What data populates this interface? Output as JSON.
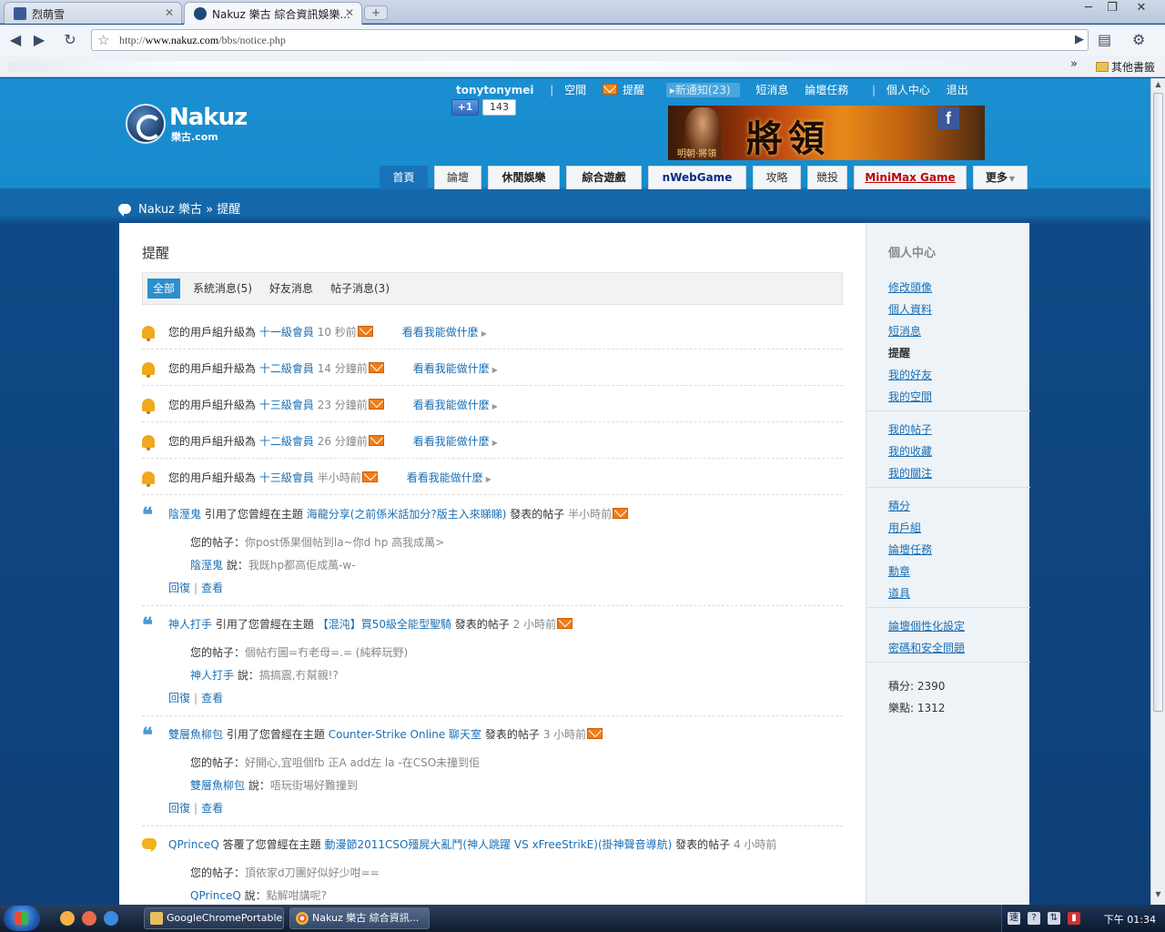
{
  "browser": {
    "tabs": [
      {
        "title": "烈萌雪",
        "active": false
      },
      {
        "title": "Nakuz 樂古 綜合資訊娛樂...",
        "active": true
      }
    ],
    "url_prefix": "http://",
    "url_host": "www.nakuz.com",
    "url_path": "/bbs/notice.php",
    "bookmarks_other": "其他書籤",
    "window_controls": [
      "─",
      "❐",
      "✕"
    ]
  },
  "header": {
    "logo_word": "Nakuz",
    "logo_sub": "樂古.com",
    "username": "tonytonymei",
    "usernav": {
      "space": "空間",
      "remind": "提醒",
      "new_notice": "新通知(23)",
      "pm": "短消息",
      "tasks": "論壇任務",
      "center": "個人中心",
      "logout": "退出"
    },
    "plusone_label": "+1",
    "plusone_count": "143",
    "banner_title": "將領",
    "banner_sub": "明朝·將領",
    "banner_fb": "f"
  },
  "mainnav": [
    {
      "label": "首頁",
      "style": "current"
    },
    {
      "label": "論壇",
      "style": ""
    },
    {
      "label": "休閒娛樂",
      "style": "bold"
    },
    {
      "label": "綜合遊戲",
      "style": "bold"
    },
    {
      "label": "nWebGame",
      "style": "navy"
    },
    {
      "label": "攻略",
      "style": ""
    },
    {
      "label": "競投",
      "style": ""
    },
    {
      "label": "MiniMax Game",
      "style": "red"
    },
    {
      "label": "更多",
      "style": "bold"
    }
  ],
  "breadcrumb": {
    "home": "Nakuz 樂古",
    "sep": "»",
    "current": "提醒"
  },
  "page_title": "提醒",
  "filters": [
    {
      "label": "全部",
      "active": true
    },
    {
      "label": "系統消息(5)",
      "active": false
    },
    {
      "label": "好友消息",
      "active": false
    },
    {
      "label": "帖子消息(3)",
      "active": false
    }
  ],
  "system_notices": [
    {
      "prefix": "您的用戶組升級為",
      "group": "十一級會員",
      "time": "10 秒前",
      "action": "看看我能做什麼"
    },
    {
      "prefix": "您的用戶組升級為",
      "group": "十二級會員",
      "time": "14 分鐘前",
      "action": "看看我能做什麼"
    },
    {
      "prefix": "您的用戶組升級為",
      "group": "十三級會員",
      "time": "23 分鐘前",
      "action": "看看我能做什麼"
    },
    {
      "prefix": "您的用戶組升級為",
      "group": "十二級會員",
      "time": "26 分鐘前",
      "action": "看看我能做什麼"
    },
    {
      "prefix": "您的用戶組升級為",
      "group": "十三級會員",
      "time": "半小時前",
      "action": "看看我能做什麼"
    }
  ],
  "post_notices": [
    {
      "user": "陰溼鬼",
      "verb": "引用了您曾經在主題",
      "topic": "海龍分享(之前係米話加分?版主入來睇睇)",
      "suffix": "發表的帖子",
      "time": "半小時前",
      "yourpost_label": "您的帖子：",
      "yourpost": "你post係果個帖到la~你d hp 高我成萬>",
      "said": "說：",
      "reply": "我既hp都高佢成萬-w-",
      "reply_link": "回復",
      "view_link": "查看"
    },
    {
      "user": "神人打手",
      "verb": "引用了您曾經在主題",
      "topic": "【混沌】買50級全能型聖騎",
      "suffix": "發表的帖子",
      "time": "2 小時前",
      "yourpost_label": "您的帖子：",
      "yourpost": "個帖冇圖=冇老母=.= (純粹玩野)",
      "said": "說：",
      "reply": "搞搞震,冇幫親!?",
      "reply_link": "回復",
      "view_link": "查看"
    },
    {
      "user": "雙層魚柳包",
      "verb": "引用了您曾經在主題",
      "topic": "Counter-Strike Online 聊天室",
      "suffix": "發表的帖子",
      "time": "3 小時前",
      "yourpost_label": "您的帖子：",
      "yourpost": "好開心,宜咀個fb 正A add左 la -在CSO未撞到佢",
      "said": "說：",
      "reply": "唔玩街場好難撞到",
      "reply_link": "回復",
      "view_link": "查看"
    },
    {
      "user": "QPrinceQ",
      "verb": "答覆了您曾經在主題",
      "topic": "動漫節2011CSO殭屍大亂鬥(神人跳躍 VS xFreeStrikE)(掛神聲音導航)",
      "suffix": "發表的帖子",
      "time": "4 小時前",
      "yourpost_label": "您的帖子：",
      "yourpost": "頂依家d刀團好似好少咁==",
      "said": "說：",
      "reply": "點解咁講呢?"
    }
  ],
  "sidebar": {
    "title": "個人中心",
    "groups": [
      [
        "修改頭像",
        "個人資料",
        "短消息",
        "提醒",
        "我的好友",
        "我的空間"
      ],
      [
        "我的帖子",
        "我的收藏",
        "我的關注"
      ],
      [
        "積分",
        "用戶組",
        "論壇任務",
        "勳章",
        "道具"
      ],
      [
        "論壇個性化設定",
        "密碼和安全問題"
      ]
    ],
    "current": "提醒",
    "stats": [
      {
        "label": "積分: 2390"
      },
      {
        "label": "樂點: 1312"
      }
    ]
  },
  "taskbar": {
    "tasks": [
      {
        "label": "GoogleChromePortable",
        "active": false
      },
      {
        "label": "Nakuz 樂古 綜合資訊...",
        "active": true
      }
    ],
    "tray_ime": "速",
    "clock": "下午 01:34"
  }
}
